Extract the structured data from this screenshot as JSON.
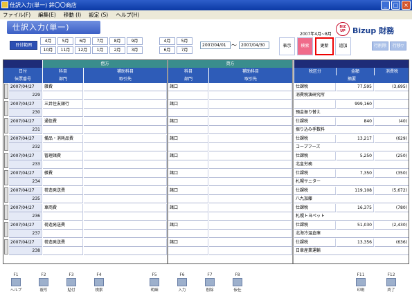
{
  "window": {
    "title": "仕訳入力(単一)  鉾〇〇商店",
    "min": "_",
    "max": "□",
    "close": "×"
  },
  "menu": [
    "ファイル(F)",
    "編集(E)",
    "移動 (I)",
    "設定 (S)",
    "ヘルプ(H)"
  ],
  "page_title": "仕訳入力(単一)",
  "period": "2007年4月~8月",
  "brand": "Bizup 財務",
  "logo_text": "BIZ UP",
  "date_range_label": "日付範囲",
  "months_row1": [
    "4月",
    "5月",
    "6月",
    "7月",
    "8月",
    "9月"
  ],
  "months_row2": [
    "10月",
    "11月",
    "12月",
    "1月",
    "2月",
    "3月"
  ],
  "months_right1": [
    "4月",
    "5月"
  ],
  "months_right2": [
    "6月",
    "7月"
  ],
  "date_from": "2007/04/01",
  "date_tilde": "～",
  "date_to": "2007/04/30",
  "actions": {
    "show": "表示",
    "search": "検索",
    "update": "更新",
    "add": "追加",
    "print1": "行削除",
    "print2": "行移▽"
  },
  "headers": {
    "debit": "借方",
    "credit": "貸方",
    "date": "日付",
    "slip": "伝票番号",
    "kamoku": "科目",
    "hojo": "補助科目",
    "dept": "部門",
    "tori": "取引先",
    "kamoku2": "科目",
    "hojo2": "補助科目",
    "dept2": "部門",
    "tori2": "取引先",
    "tax_kind": "税区分",
    "amount": "金額",
    "ctax": "消費税",
    "teki": "摘要"
  },
  "rows": [
    {
      "date": "2007/04/27",
      "slip": "229",
      "debit": "雑費",
      "credit": "諸口",
      "tax": "仕課税",
      "amount": "77,595",
      "ctax": "(3,695)",
      "teki": "消費税演研究所"
    },
    {
      "date": "2007/04/27",
      "slip": "230",
      "debit": "三井住友銀行",
      "credit": "諸口",
      "tax": "",
      "amount": "999,160",
      "ctax": "",
      "teki": "預金振り替え"
    },
    {
      "date": "2007/04/27",
      "slip": "231",
      "debit": "通信費",
      "credit": "諸口",
      "tax": "仕課税",
      "amount": "840",
      "ctax": "(40)",
      "teki": "振り込み手数料"
    },
    {
      "date": "2007/04/27",
      "slip": "232",
      "debit": "備品・消耗品費",
      "credit": "諸口",
      "tax": "仕課税",
      "amount": "13,217",
      "ctax": "(629)",
      "teki": "コープフーズ"
    },
    {
      "date": "2007/04/27",
      "slip": "233",
      "debit": "管理諸費",
      "credit": "諸口",
      "tax": "仕課税",
      "amount": "5,250",
      "ctax": "(250)",
      "teki": "北皇労務"
    },
    {
      "date": "2007/04/27",
      "slip": "234",
      "debit": "雑費",
      "credit": "諸口",
      "tax": "仕課税",
      "amount": "7,350",
      "ctax": "(350)",
      "teki": "札幌サニター"
    },
    {
      "date": "2007/04/27",
      "slip": "235",
      "debit": "荷造発送費",
      "credit": "諸口",
      "tax": "仕課税",
      "amount": "119,108",
      "ctax": "(5,672)",
      "teki": "八九加藤"
    },
    {
      "date": "2007/04/27",
      "slip": "236",
      "debit": "車両費",
      "credit": "諸口",
      "tax": "仕課税",
      "amount": "16,375",
      "ctax": "(780)",
      "teki": "札幌トヨペット"
    },
    {
      "date": "2007/04/27",
      "slip": "237",
      "debit": "荷造発送費",
      "credit": "諸口",
      "tax": "仕課税",
      "amount": "51,030",
      "ctax": "(2,430)",
      "teki": "北海冷温倉庫"
    },
    {
      "date": "2007/04/27",
      "slip": "238",
      "debit": "荷造発送費",
      "credit": "諸口",
      "tax": "仕課税",
      "amount": "13,356",
      "ctax": "(636)",
      "teki": "日章産業運輸"
    }
  ],
  "fkeys": [
    {
      "key": "F1",
      "label": "ヘルプ"
    },
    {
      "key": "F2",
      "label": "複写"
    },
    {
      "key": "F3",
      "label": "貼付"
    },
    {
      "key": "F4",
      "label": "検索"
    },
    {
      "key": "F5",
      "label": "明細"
    },
    {
      "key": "F6",
      "label": "入力"
    },
    {
      "key": "F7",
      "label": "削除"
    },
    {
      "key": "F8",
      "label": "仮仕"
    },
    {
      "key": "F11",
      "label": "印刷"
    },
    {
      "key": "F12",
      "label": "終了"
    }
  ]
}
